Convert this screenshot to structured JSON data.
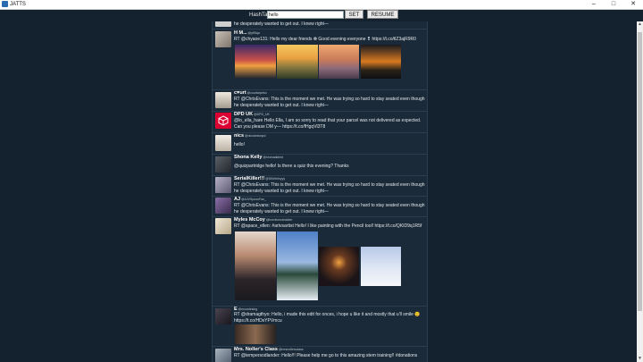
{
  "window": {
    "title": "JATTS",
    "minimize": "–",
    "maximize": "□",
    "close": "✕"
  },
  "search": {
    "label": "HashTag",
    "value": "hello",
    "set_label": "SET",
    "resume_label": "RESUME"
  },
  "scroll": {
    "up": "▲",
    "down": "▼"
  },
  "tweets": [
    {
      "name": "",
      "handle": "",
      "text": "he desperately wanted to get out. I knew right—",
      "avatar_color": "#cfcfcf"
    },
    {
      "name": "H M...",
      "handle": "@pf5lqa",
      "text": "RT @chyaoe131: Hello my dear friends ❁ Good evening everyone ❢ https://t.co/tlZ3ajR9R0",
      "avatar_color": "#9a8f86"
    },
    {
      "name": "c♥urt",
      "handle": "@courtarpeko",
      "text": "RT @ChrisEvans: This is the moment we met. He was trying so hard to stay seated even though he desperately wanted to get out. I knew right—",
      "avatar_color": "#d8d2c8"
    },
    {
      "name": "DPD UK",
      "handle": "@DPD_UK",
      "text": "@lo_ella_hare Hello Ella, I am so sorry to read that your parcel was not delivered as expected. Can you please DM y— https://t.co/fHgqVl3T8",
      "avatar_color": "#dc0032"
    },
    {
      "name": "nics",
      "handle": "@nicolantonpd",
      "text": "hello!",
      "avatar_color": "#e9e4dc"
    },
    {
      "name": "Shona Kelly",
      "handle": "@shonaakbird",
      "text": "@quizpartridge hello! Is there a quiz this evening? Thanks",
      "avatar_color": "#3a4048"
    },
    {
      "name": "SerialKiller!!!",
      "handle": "@SKiehlmyyy",
      "text": "RT @ChrisEvans: This is the moment we met. He was trying so hard to stay seated even though he desperately wanted to get out. I knew right—",
      "avatar_color": "#8d8aa3"
    },
    {
      "name": "AJ",
      "handle": "@AJVSpoonFan_",
      "text": "RT @ChrisEvans: This is the moment we met. He was trying so hard to stay seated even though he desperately wanted to get out. I knew right—",
      "avatar_color": "#5b4a6e"
    },
    {
      "name": "Myles McCoy",
      "handle": "@bornfunnainsider",
      "text": "RT @space_ellen: #artvsartist Hello! I like painting with the Pencil tool! https://t.co/QKID9q1R5f",
      "avatar_color": "#e0d6c3"
    },
    {
      "name": "E",
      "handle": "@moonlesing",
      "text": "RT @dramagthyo: Hello, i made this edit for onces, i hope u like it and mostly that u'll smile 😊 https://t.co/HDsYPVmcu",
      "avatar_color": "#2e2e36"
    },
    {
      "name": "Mrs. Noller's Class",
      "handle": "@mrsnollersclass",
      "text": "RT @tempersodlander: Hello!!! Please help me go to this amazing stem training!! #donations",
      "avatar_color": "#7a8795"
    }
  ]
}
